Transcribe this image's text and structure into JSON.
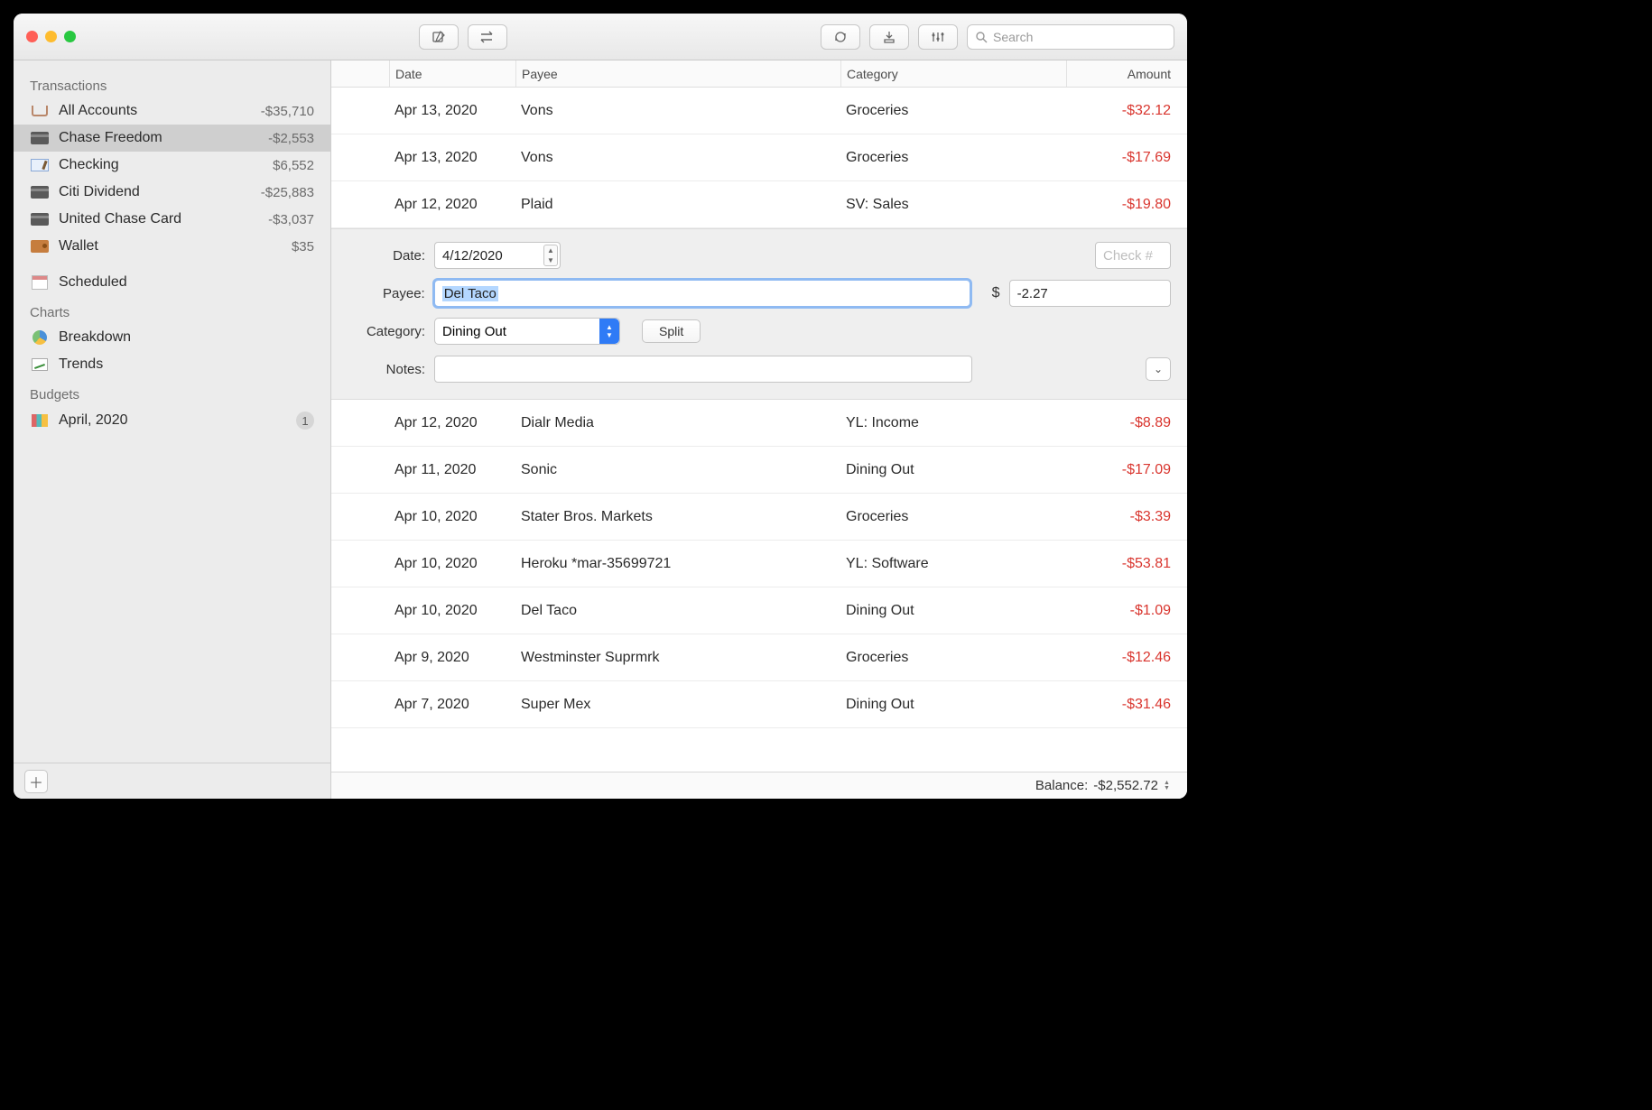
{
  "search_placeholder": "Search",
  "sidebar": {
    "groups": [
      {
        "label": "Transactions"
      },
      {
        "label": "Charts"
      },
      {
        "label": "Budgets"
      }
    ],
    "accounts": [
      {
        "name": "All Accounts",
        "value": "-$35,710"
      },
      {
        "name": "Chase Freedom",
        "value": "-$2,553"
      },
      {
        "name": "Checking",
        "value": "$6,552"
      },
      {
        "name": "Citi Dividend",
        "value": "-$25,883"
      },
      {
        "name": "United Chase Card",
        "value": "-$3,037"
      },
      {
        "name": "Wallet",
        "value": "$35"
      }
    ],
    "scheduled": "Scheduled",
    "charts": [
      {
        "name": "Breakdown"
      },
      {
        "name": "Trends"
      }
    ],
    "budgets": [
      {
        "name": "April, 2020",
        "badge": "1"
      }
    ]
  },
  "columns": {
    "date": "Date",
    "payee": "Payee",
    "category": "Category",
    "amount": "Amount"
  },
  "tx_before": [
    {
      "date": "Apr 13, 2020",
      "payee": "Vons",
      "category": "Groceries",
      "amount": "-$32.12"
    },
    {
      "date": "Apr 13, 2020",
      "payee": "Vons",
      "category": "Groceries",
      "amount": "-$17.69"
    },
    {
      "date": "Apr 12, 2020",
      "payee": "Plaid",
      "category": "SV: Sales",
      "amount": "-$19.80"
    }
  ],
  "edit": {
    "labels": {
      "date": "Date:",
      "payee": "Payee:",
      "category": "Category:",
      "notes": "Notes:"
    },
    "date_value": "4/12/2020",
    "payee_value": "Del Taco",
    "amount_value": "-2.27",
    "currency": "$",
    "category_value": "Dining Out",
    "split_label": "Split",
    "check_placeholder": "Check #",
    "notes_value": ""
  },
  "tx_after": [
    {
      "date": "Apr 12, 2020",
      "payee": "Dialr Media",
      "category": "YL: Income",
      "amount": "-$8.89"
    },
    {
      "date": "Apr 11, 2020",
      "payee": "Sonic",
      "category": "Dining Out",
      "amount": "-$17.09"
    },
    {
      "date": "Apr 10, 2020",
      "payee": "Stater Bros. Markets",
      "category": "Groceries",
      "amount": "-$3.39"
    },
    {
      "date": "Apr 10, 2020",
      "payee": "Heroku *mar-35699721",
      "category": "YL: Software",
      "amount": "-$53.81"
    },
    {
      "date": "Apr 10, 2020",
      "payee": "Del Taco",
      "category": "Dining Out",
      "amount": "-$1.09"
    },
    {
      "date": "Apr 9, 2020",
      "payee": "Westminster Suprmrk",
      "category": "Groceries",
      "amount": "-$12.46"
    },
    {
      "date": "Apr 7, 2020",
      "payee": "Super Mex",
      "category": "Dining Out",
      "amount": "-$31.46"
    }
  ],
  "status": {
    "label": "Balance:",
    "value": "-$2,552.72"
  }
}
